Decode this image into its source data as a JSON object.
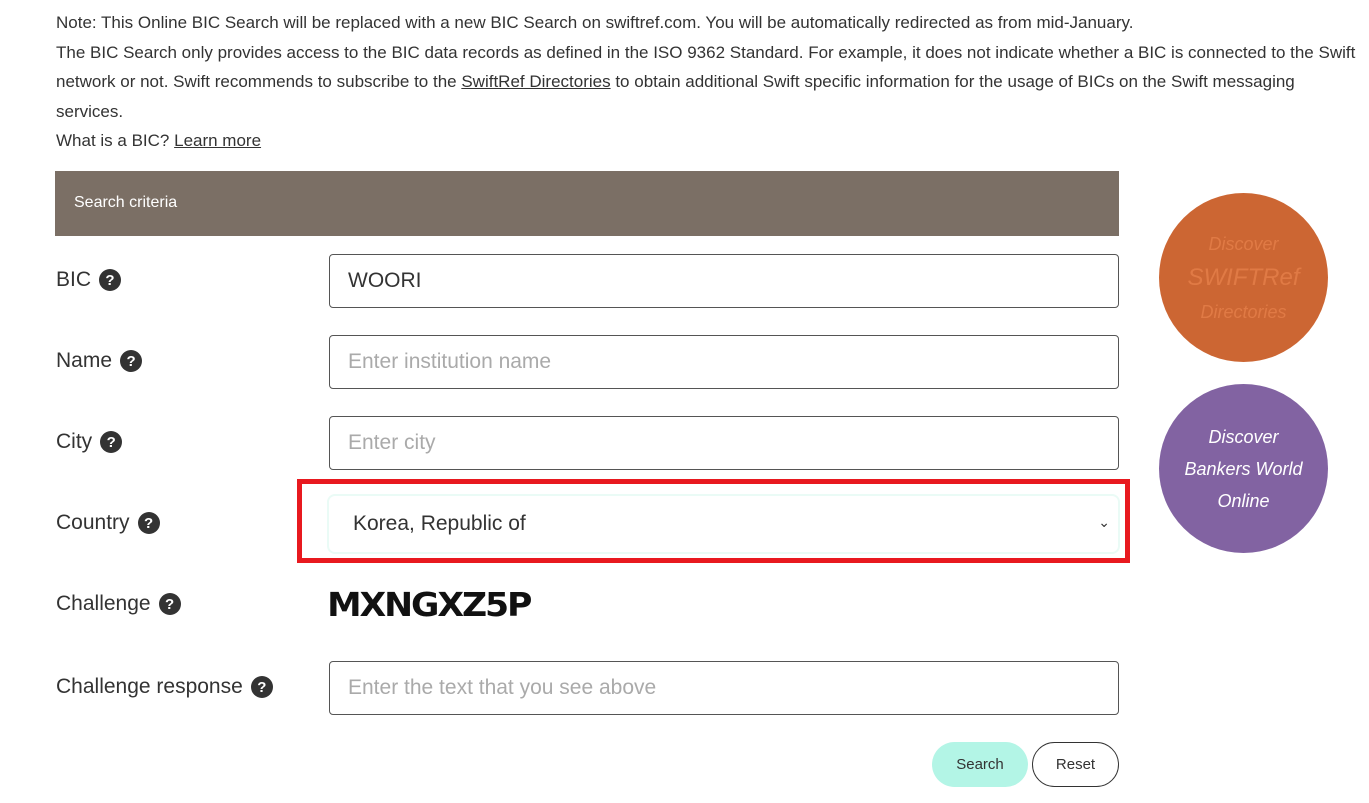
{
  "intro": {
    "note": "Note: This Online BIC Search will be replaced with a new BIC Search on swiftref.com. You will be automatically redirected as from mid-January.",
    "p1": "The BIC Search only provides access to the BIC data records as defined in the ISO 9362 Standard. For example, it does not indicate whether a BIC is connected to the Swift network or not. Swift recommends to subscribe to the ",
    "link1": "SwiftRef Directories",
    "p1b": " to obtain additional Swift specific information for the usage of BICs on the Swift messaging services.",
    "p2": "What is a BIC? ",
    "link2": "Learn more"
  },
  "form": {
    "header": "Search criteria",
    "help_glyph": "?",
    "bic": {
      "label": "BIC",
      "value": "WOORI"
    },
    "name": {
      "label": "Name",
      "placeholder": "Enter institution name"
    },
    "city": {
      "label": "City",
      "placeholder": "Enter city"
    },
    "country": {
      "label": "Country",
      "value": "Korea, Republic of"
    },
    "challenge": {
      "label": "Challenge",
      "captcha": "MXNGXZ5P"
    },
    "response": {
      "label": "Challenge response",
      "placeholder": "Enter the text that you see above"
    },
    "search": "Search",
    "reset": "Reset"
  },
  "promos": {
    "swiftref": {
      "l1": "Discover",
      "l2": "SWIFTRef",
      "l3": "Directories",
      "color": "#cc6633"
    },
    "bankers": {
      "l1": "Discover",
      "l2": "Bankers World",
      "l3": "Online",
      "color": "#8263a2"
    }
  },
  "colors": {
    "highlight": "#e8191f",
    "search_button": "#b3f5e6",
    "header": "#7b6f65"
  }
}
